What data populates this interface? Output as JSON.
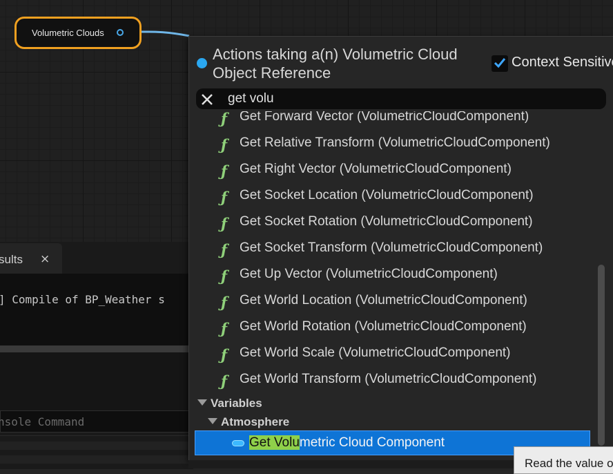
{
  "graph": {
    "node_label": "Volumetric Clouds"
  },
  "bottom_panel": {
    "tab_label": "sults",
    "tab_close": "×",
    "log_line": "] Compile of BP_Weather s",
    "console_placeholder": "nsole Command"
  },
  "menu": {
    "title": "Actions taking a(n) Volumetric Cloud Object Reference",
    "context_sensitive_label": "Context Sensitive",
    "context_sensitive_checked": true,
    "search_value": "get volu",
    "function_icon": "ƒ",
    "functions": [
      "Get Forward Vector (VolumetricCloudComponent)",
      "Get Relative Transform (VolumetricCloudComponent)",
      "Get Right Vector (VolumetricCloudComponent)",
      "Get Socket Location (VolumetricCloudComponent)",
      "Get Socket Rotation (VolumetricCloudComponent)",
      "Get Socket Transform (VolumetricCloudComponent)",
      "Get Up Vector (VolumetricCloudComponent)",
      "Get World Location (VolumetricCloudComponent)",
      "Get World Rotation (VolumetricCloudComponent)",
      "Get World Scale (VolumetricCloudComponent)",
      "Get World Transform (VolumetricCloudComponent)"
    ],
    "category_variables": "Variables",
    "category_atmosphere": "Atmosphere",
    "selected_item": {
      "match": "Get Volu",
      "rest": "metric Cloud Component"
    }
  },
  "tooltip": {
    "text": "Read the value o"
  },
  "colors": {
    "node_border": "#f0a020",
    "pin": "#49a8e8",
    "function_icon": "#8fd07a",
    "selection": "#0e74d6",
    "search_highlight": "#8fd04a"
  }
}
